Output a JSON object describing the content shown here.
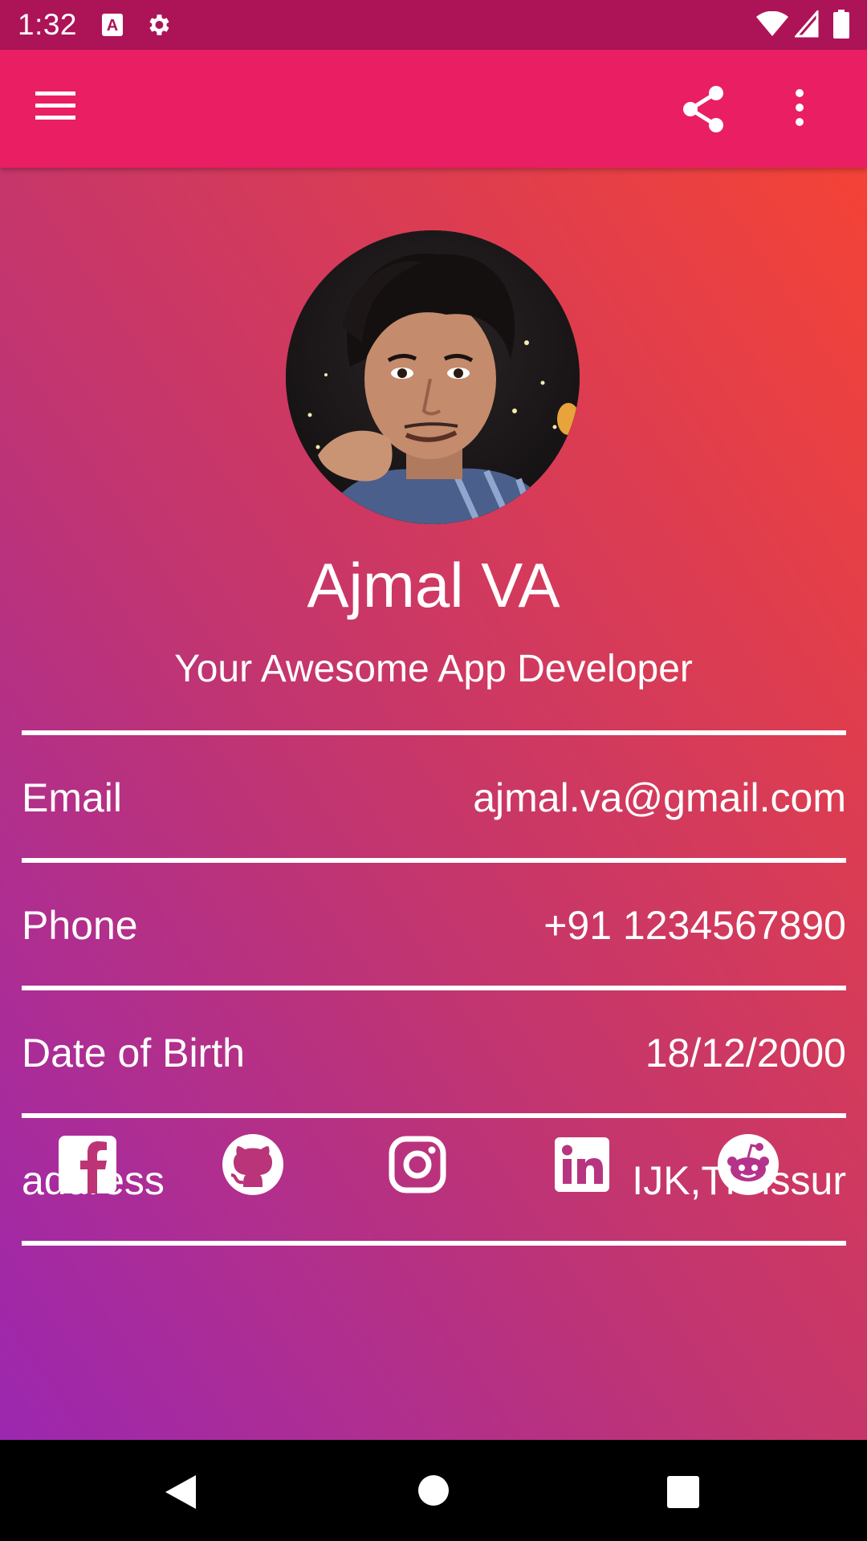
{
  "status_bar": {
    "time": "1:32",
    "icons": [
      "font-a-icon",
      "settings-gear-icon",
      "wifi-icon",
      "signal-icon",
      "battery-icon"
    ]
  },
  "toolbar": {
    "icons": [
      "menu-icon",
      "share-icon",
      "more-vert-icon"
    ],
    "background": "#e91e63"
  },
  "profile": {
    "name": "Ajmal VA",
    "tagline": "Your Awesome App Developer"
  },
  "details": [
    {
      "label": "Email",
      "value": "ajmal.va@gmail.com"
    },
    {
      "label": "Phone",
      "value": "+91 1234567890"
    },
    {
      "label": "Date of Birth",
      "value": "18/12/2000"
    },
    {
      "label": "address",
      "value": "IJK,Thrissur"
    }
  ],
  "social": [
    "facebook-icon",
    "github-icon",
    "instagram-icon",
    "linkedin-icon",
    "reddit-icon"
  ],
  "nav_bar": [
    "back-icon",
    "home-icon",
    "recents-icon"
  ],
  "colors": {
    "status_bar": "#ad1457",
    "gradient_start": "#9c27b0",
    "gradient_end": "#f44336"
  }
}
